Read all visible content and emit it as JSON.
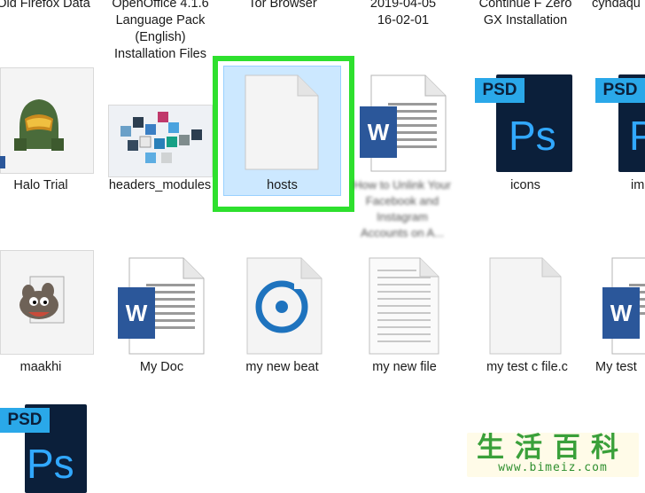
{
  "top_row": {
    "labels": [
      [
        "Old Firefox Data"
      ],
      [
        "OpenOffice 4.1.6",
        "Language Pack",
        "(English)",
        "Installation Files"
      ],
      [
        "Tor Browser"
      ],
      [
        "2019-04-05",
        "16-02-01"
      ],
      [
        "Continue F Zero",
        "GX Installation"
      ],
      [
        "cyndaqu"
      ]
    ]
  },
  "row1": [
    {
      "label": "Halo Trial",
      "icon": "halo-icon"
    },
    {
      "label": "headers_modules",
      "icon": "modules-icon"
    },
    {
      "label": "hosts",
      "icon": "blank-file-icon",
      "selected": true
    },
    {
      "label": "How to Unlink Your Facebook and Instagram Accounts on A...",
      "icon": "word-doc-icon",
      "blurred": true
    },
    {
      "label": "icons",
      "icon": "psd-icon"
    },
    {
      "label": "im",
      "icon": "psd-icon"
    }
  ],
  "row2": [
    {
      "label": "maakhi",
      "icon": "gimp-icon"
    },
    {
      "label": "My Doc",
      "icon": "word-doc-icon"
    },
    {
      "label": "my new beat",
      "icon": "groove-icon"
    },
    {
      "label": "my new file",
      "icon": "text-file-icon"
    },
    {
      "label": "my test c file.c",
      "icon": "blank-file-icon"
    },
    {
      "label": "My test",
      "icon": "word-doc-icon"
    }
  ],
  "row3": [
    {
      "label": "",
      "icon": "psd-icon"
    }
  ],
  "badges": {
    "word": "W",
    "psd_tab": "PSD",
    "psd_ps": "Ps"
  },
  "watermark": {
    "chars": "生活百科",
    "url": "www.bimeiz.com"
  },
  "colors": {
    "selection_fill": "#cce8ff",
    "highlight_border": "#2ee02e",
    "word_blue": "#2b579a",
    "psd_navy": "#0b1f3a",
    "psd_cyan": "#31a8ff"
  }
}
